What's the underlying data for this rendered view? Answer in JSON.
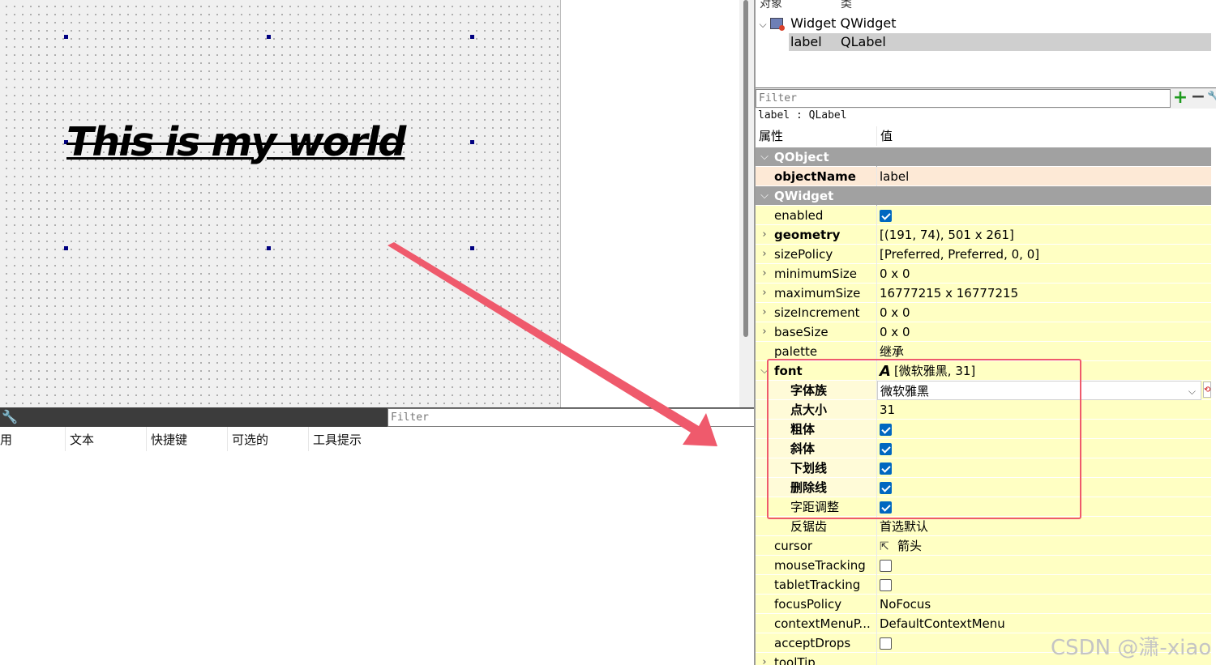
{
  "form": {
    "label_text": "This is my world"
  },
  "action_editor": {
    "filter_placeholder": "Filter",
    "columns": [
      "用",
      "文本",
      "快捷键",
      "可选的",
      "工具提示"
    ]
  },
  "object_inspector": {
    "col_object": "对象",
    "col_class": "类",
    "items": [
      {
        "name": "Widget",
        "class": "QWidget"
      },
      {
        "name": "label",
        "class": "QLabel"
      }
    ]
  },
  "property_editor": {
    "filter_placeholder": "Filter",
    "current_object": "label : QLabel",
    "col_property": "属性",
    "col_value": "值",
    "rows": [
      {
        "kind": "group",
        "name": "QObject"
      },
      {
        "kind": "prop",
        "name": "objectName",
        "value": "label",
        "bold": true
      },
      {
        "kind": "group",
        "name": "QWidget"
      },
      {
        "kind": "prop",
        "name": "enabled",
        "value": "checked"
      },
      {
        "kind": "prop",
        "name": "geometry",
        "value": "[(191, 74), 501 x 261]",
        "bold": true,
        "expandable": true
      },
      {
        "kind": "prop",
        "name": "sizePolicy",
        "value": "[Preferred, Preferred, 0, 0]",
        "expandable": true
      },
      {
        "kind": "prop",
        "name": "minimumSize",
        "value": "0 x 0",
        "expandable": true
      },
      {
        "kind": "prop",
        "name": "maximumSize",
        "value": "16777215 x 16777215",
        "expandable": true
      },
      {
        "kind": "prop",
        "name": "sizeIncrement",
        "value": "0 x 0",
        "expandable": true
      },
      {
        "kind": "prop",
        "name": "baseSize",
        "value": "0 x 0",
        "expandable": true
      },
      {
        "kind": "prop",
        "name": "palette",
        "value": "继承"
      },
      {
        "kind": "prop",
        "name": "font",
        "value": "[微软雅黑, 31]",
        "bold": true,
        "expanded": true
      },
      {
        "kind": "sub",
        "name": "字体族",
        "value": "微软雅黑"
      },
      {
        "kind": "sub",
        "name": "点大小",
        "value": "31"
      },
      {
        "kind": "sub",
        "name": "粗体",
        "value": "checked"
      },
      {
        "kind": "sub",
        "name": "斜体",
        "value": "checked"
      },
      {
        "kind": "sub",
        "name": "下划线",
        "value": "checked"
      },
      {
        "kind": "sub",
        "name": "删除线",
        "value": "checked"
      },
      {
        "kind": "sub-plain",
        "name": "字距调整",
        "value": "checked"
      },
      {
        "kind": "sub-plain",
        "name": "反锯齿",
        "value": "首选默认"
      },
      {
        "kind": "prop",
        "name": "cursor",
        "value": "箭头"
      },
      {
        "kind": "prop",
        "name": "mouseTracking",
        "value": "unchecked"
      },
      {
        "kind": "prop",
        "name": "tabletTracking",
        "value": "unchecked"
      },
      {
        "kind": "prop",
        "name": "focusPolicy",
        "value": "NoFocus"
      },
      {
        "kind": "prop",
        "name": "contextMenuP...",
        "value": "DefaultContextMenu"
      },
      {
        "kind": "prop",
        "name": "acceptDrops",
        "value": "unchecked"
      },
      {
        "kind": "prop",
        "name": "toolTip",
        "value": "",
        "expandable": true
      }
    ]
  },
  "watermark": "CSDN @潇-xiao",
  "colors": {
    "annotation_red": "#ef5a6c",
    "checkbox_blue": "#0067c0",
    "group_grey": "#a1a1a1",
    "row_yellow": "#ffffc3"
  },
  "icons": [
    "wrench-icon",
    "widget-icon",
    "add-icon",
    "remove-icon",
    "font-icon",
    "cursor-arrow-icon",
    "combo-arrow-icon",
    "reset-icon"
  ]
}
